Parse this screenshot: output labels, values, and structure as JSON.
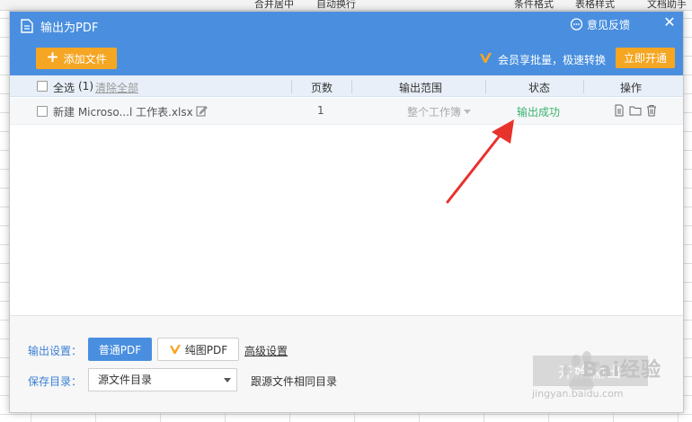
{
  "background": {
    "toolbar_items": [
      "合并居中",
      "自动换行",
      "条件格式",
      "表格样式",
      "文档助手"
    ]
  },
  "dialog": {
    "title": "输出为PDF",
    "feedback": "意见反馈",
    "close_glyph": "✕",
    "add_file": "添加文件",
    "vip_text": "会员享批量，极速转换",
    "open_vip": "立即开通"
  },
  "table": {
    "select_all": "全选",
    "selected_count": "(1)",
    "clear_all": "清除全部",
    "headers": {
      "pages": "页数",
      "range": "输出范围",
      "status": "状态",
      "actions": "操作"
    },
    "rows": [
      {
        "name": "新建 Microso...l 工作表.xlsx",
        "pages": "1",
        "range": "整个工作簿",
        "status": "输出成功"
      }
    ]
  },
  "footer": {
    "output_settings_label": "输出设置：",
    "normal_pdf": "普通PDF",
    "image_pdf": "纯图PDF",
    "advanced": "高级设置",
    "save_dir_label": "保存目录：",
    "save_dir_value": "源文件目录",
    "save_dir_note": "跟源文件相同目录",
    "start_button": "开始输出"
  },
  "watermark": {
    "brand": "Bai经验",
    "url": "jingyan.baidu.com"
  },
  "colors": {
    "header_blue": "#4a8fdf",
    "accent_orange": "#f5a623",
    "success_green": "#3cb371",
    "label_blue": "#3a7fd5",
    "arrow_red": "#e8322c"
  }
}
